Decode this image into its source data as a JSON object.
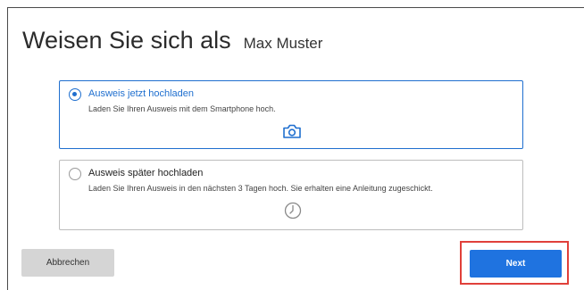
{
  "header": {
    "title": "Weisen Sie sich als",
    "user_name": "Max Muster"
  },
  "options": [
    {
      "title": "Ausweis jetzt hochladen",
      "description": "Laden Sie Ihren Ausweis mit dem Smartphone hoch.",
      "icon": "camera-icon",
      "selected": true
    },
    {
      "title": "Ausweis später hochladen",
      "description": "Laden Sie Ihren Ausweis in den nächsten 3 Tagen hoch. Sie erhalten eine Anleitung zugeschickt.",
      "icon": "clock-icon",
      "selected": false
    }
  ],
  "actions": {
    "cancel_label": "Abbrechen",
    "next_label": "Next"
  },
  "colors": {
    "accent": "#1f73e0",
    "highlight": "#e0403a",
    "cancel_bg": "#d5d5d5"
  }
}
